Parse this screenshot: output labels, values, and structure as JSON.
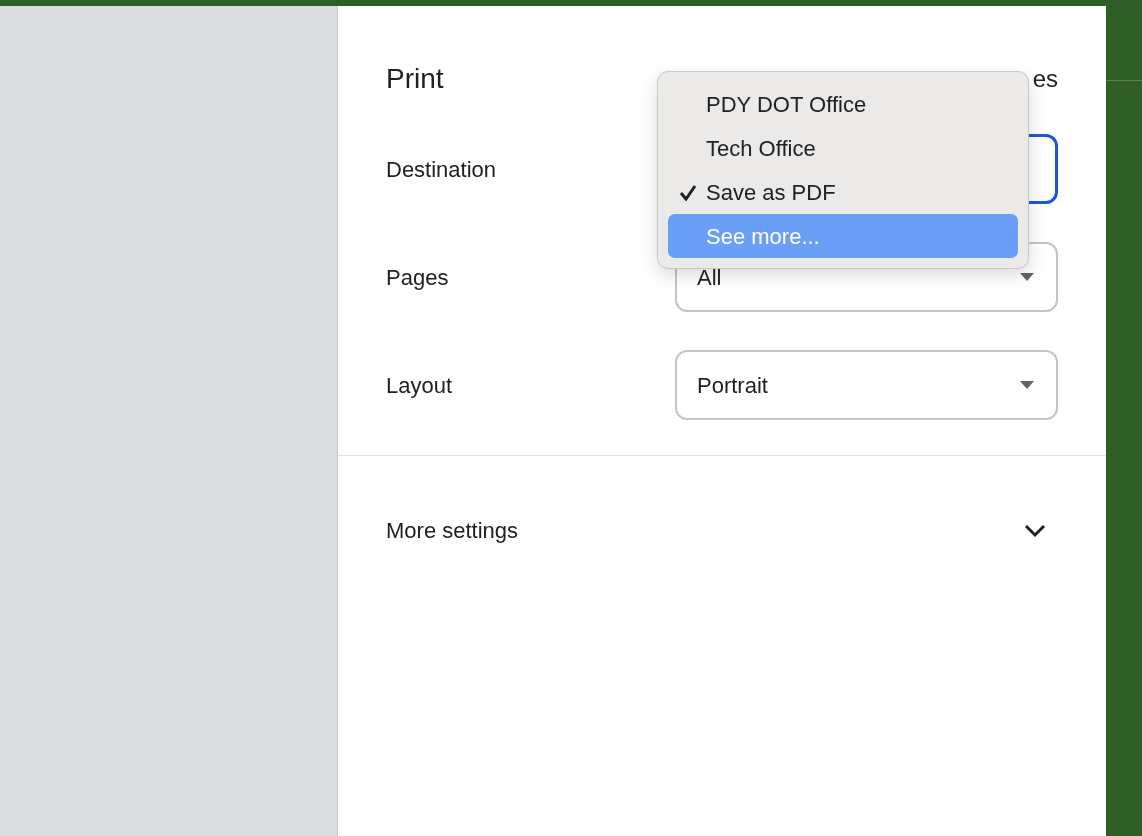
{
  "header": {
    "title": "Print",
    "summary": "es"
  },
  "settings": [
    {
      "label": "Destination",
      "focused": true
    },
    {
      "label": "Pages",
      "value": "All",
      "focused": false
    },
    {
      "label": "Layout",
      "value": "Portrait",
      "focused": false
    }
  ],
  "destination_menu": {
    "items": [
      {
        "label": "PDY DOT Office",
        "checked": false,
        "selected": false
      },
      {
        "label": "Tech Office",
        "checked": false,
        "selected": false
      },
      {
        "label": "Save as PDF",
        "checked": true,
        "selected": false
      },
      {
        "label": "See more...",
        "checked": false,
        "selected": true
      }
    ]
  },
  "more_settings": {
    "label": "More settings",
    "expanded": false
  }
}
